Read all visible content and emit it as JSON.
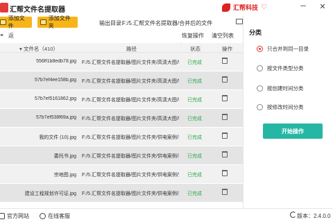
{
  "app": {
    "title": "汇帮文件名提取器",
    "brand": "汇帮科技"
  },
  "window_controls": [
    "─",
    "✕"
  ],
  "toolbar": {
    "add_file": "添加文件",
    "add_folder": "添加文件夹",
    "output_label": "输出目录:",
    "output_path": "F:/5.汇帮文件名提取器/合并后的文件"
  },
  "actions": {
    "back": "返",
    "restore": "恢复操作",
    "clear": "清空列表"
  },
  "table": {
    "headers": {
      "name": "▾ 文件名（410）",
      "path": "路径",
      "status": "状态",
      "op": "操作"
    },
    "rows": [
      {
        "name": "556ff1b8edb78.jpg",
        "path": "F:/5.汇帮文件名提取器/图片文件夹/高清大图/55",
        "status": "已完成"
      },
      {
        "name": "57b7ef4ee158b.jpg",
        "path": "F:/5.汇帮文件名提取器/图片文件夹/高清大图/57",
        "status": "已完成"
      },
      {
        "name": "57b7ef5161862.jpg",
        "path": "F:/5.汇帮文件名提取器/图片文件夹/高清大图/57",
        "status": "已完成"
      },
      {
        "name": "57b7ef538f69a.jpg",
        "path": "F:/5.汇帮文件名提取器/图片文件夹/高清大图/57",
        "status": "已完成"
      },
      {
        "name": "我的文件 (10).jpg",
        "path": "F:/5.汇帮文件名提取器/图片文件夹/供电案例/我",
        "status": "已完成"
      },
      {
        "name": "委托书.jpg",
        "path": "F:/5.汇帮文件名提取器/图片文件夹/供电案例/委",
        "status": "已完成"
      },
      {
        "name": "宗地图.jpg",
        "path": "F:/5.汇帮文件名提取器/图片文件夹/供电案例/宗",
        "status": "已完成"
      },
      {
        "name": "建设工程规划许可证.jpg",
        "path": "F:/5.汇帮文件名提取器/图片文件夹/供电案例/建",
        "status": "已完成"
      }
    ]
  },
  "panel": {
    "title": "分类",
    "options": [
      {
        "label": "只合并到同一目录",
        "selected": true
      },
      {
        "label": "按文件类型分类",
        "selected": false
      },
      {
        "label": "按创建时间分类",
        "selected": false
      },
      {
        "label": "按修改时间分类",
        "selected": false
      }
    ],
    "start": "开始操作"
  },
  "footer": {
    "official_site": "官方网站",
    "online_service": "在线客服",
    "version": "版本：2.4.0.0"
  },
  "colors": {
    "accent_yellow": "#f7b519",
    "start_teal": "#26b7a4",
    "status_green": "#2aa84a",
    "brand_red": "#e23a3a"
  }
}
